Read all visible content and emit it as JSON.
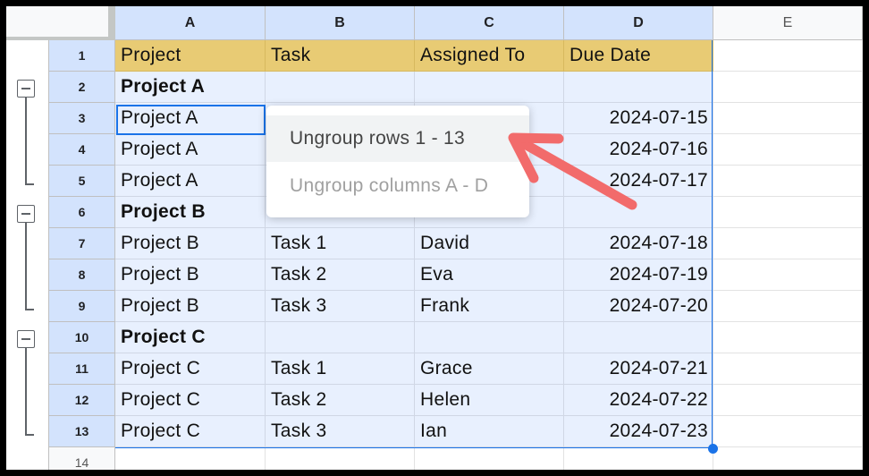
{
  "columns": [
    "A",
    "B",
    "C",
    "D",
    "E"
  ],
  "rows": [
    {
      "num": "1",
      "cells": [
        "Project",
        "Task",
        "Assigned To",
        "Due Date"
      ]
    },
    {
      "num": "2",
      "cells": [
        "Project A",
        "",
        "",
        ""
      ]
    },
    {
      "num": "3",
      "cells": [
        "Project A",
        "",
        "",
        "2024-07-15"
      ]
    },
    {
      "num": "4",
      "cells": [
        "Project A",
        "",
        "",
        "2024-07-16"
      ]
    },
    {
      "num": "5",
      "cells": [
        "Project A",
        "",
        "",
        "2024-07-17"
      ]
    },
    {
      "num": "6",
      "cells": [
        "Project B",
        "",
        "",
        ""
      ]
    },
    {
      "num": "7",
      "cells": [
        "Project B",
        "Task 1",
        "David",
        "2024-07-18"
      ]
    },
    {
      "num": "8",
      "cells": [
        "Project B",
        "Task 2",
        "Eva",
        "2024-07-19"
      ]
    },
    {
      "num": "9",
      "cells": [
        "Project B",
        "Task 3",
        "Frank",
        "2024-07-20"
      ]
    },
    {
      "num": "10",
      "cells": [
        "Project C",
        "",
        "",
        ""
      ]
    },
    {
      "num": "11",
      "cells": [
        "Project C",
        "Task 1",
        "Grace",
        "2024-07-21"
      ]
    },
    {
      "num": "12",
      "cells": [
        "Project C",
        "Task 2",
        "Helen",
        "2024-07-22"
      ]
    },
    {
      "num": "13",
      "cells": [
        "Project C",
        "Task 3",
        "Ian",
        "2024-07-23"
      ]
    },
    {
      "num": "14",
      "cells": [
        "",
        "",
        "",
        ""
      ]
    }
  ],
  "context_menu": {
    "ungroup_rows": "Ungroup rows 1 - 13",
    "ungroup_columns": "Ungroup columns A - D"
  },
  "colors": {
    "header_fill": "#e8cb74",
    "selection_fill": "#e8f0fe",
    "selection_border": "#1a73e8",
    "arrow": "#f26b6b"
  }
}
